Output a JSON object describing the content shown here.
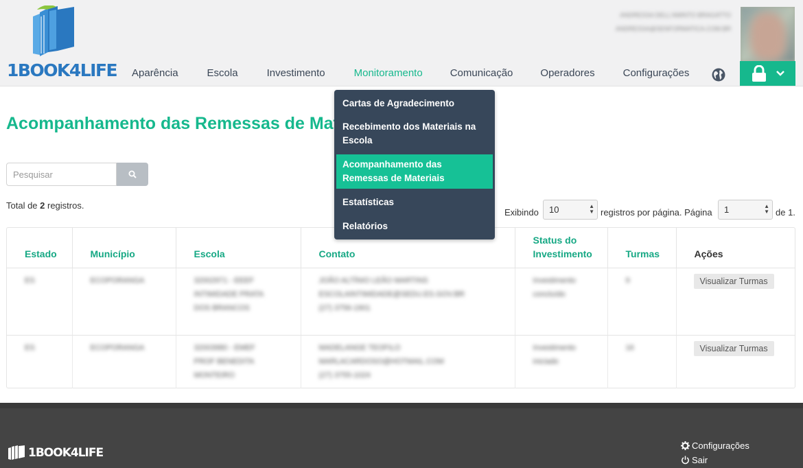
{
  "brand": {
    "logo_text": "1BOOK4LIFE",
    "primary_color": "#16b88d",
    "dark_color": "#37475a"
  },
  "user": {
    "name": "ANDRESSA DELL'AMINTO BRAGATTO",
    "email": "ANDRESSA@SENFORMATICA.COM.BR"
  },
  "nav": [
    {
      "label": "Aparência"
    },
    {
      "label": "Escola"
    },
    {
      "label": "Investimento"
    },
    {
      "label": "Monitoramento",
      "active": true
    },
    {
      "label": "Comunicação"
    },
    {
      "label": "Operadores"
    },
    {
      "label": "Configurações"
    }
  ],
  "dropdown": [
    {
      "label": "Cartas de Agradecimento"
    },
    {
      "label": "Recebimento dos Materiais na Escola"
    },
    {
      "label": "Acompanhamento das Remessas de Materiais",
      "active": true
    },
    {
      "label": "Estatísticas"
    },
    {
      "label": "Relatórios"
    }
  ],
  "page": {
    "title": "Acompanhamento das Remessas de Materiais"
  },
  "search": {
    "placeholder": "Pesquisar"
  },
  "summary": {
    "prefix": "Total de ",
    "count": "2",
    "suffix": " registros."
  },
  "pager": {
    "showing_label": "Exibindo",
    "per_page": "10",
    "per_page_label": "registros por página. Página",
    "page": "1",
    "of_label": "de 1."
  },
  "table": {
    "columns": [
      "Estado",
      "Município",
      "Escola",
      "Contato",
      "Status do Investimento",
      "Turmas",
      "Ações"
    ],
    "rows": [
      {
        "estado": "ES",
        "municipio": "ECOPORANGA",
        "escola": "32002971 - EEEF INTIMIDADE PRATA DOS BRANCOS",
        "contato_nome": "JOÃO ALTÍNIO LEÃO MARTINS",
        "contato_email": "ESCOLAINTIMIDADE@SEDU.ES.GOV.BR",
        "contato_tel": "(27) 3756-1901",
        "status": "Investimento concluído",
        "turmas": "9",
        "acao": "Visualizar Turmas"
      },
      {
        "estado": "ES",
        "municipio": "ECOPORANGA",
        "escola": "32003980 - EMEF PROF BENEDITA MONTEIRO",
        "contato_nome": "MADELANGE TEOFILO",
        "contato_email": "MARLACARDOSO@HOTMAIL.COM",
        "contato_tel": "(27) 3755-1024",
        "status": "Investimento iniciado",
        "turmas": "16",
        "acao": "Visualizar Turmas"
      }
    ]
  },
  "footer": {
    "logo_text": "1BOOK4LIFE",
    "links": [
      {
        "label": "Configurações",
        "icon": "gear-icon"
      },
      {
        "label": "Sair",
        "icon": "power-icon"
      }
    ]
  }
}
